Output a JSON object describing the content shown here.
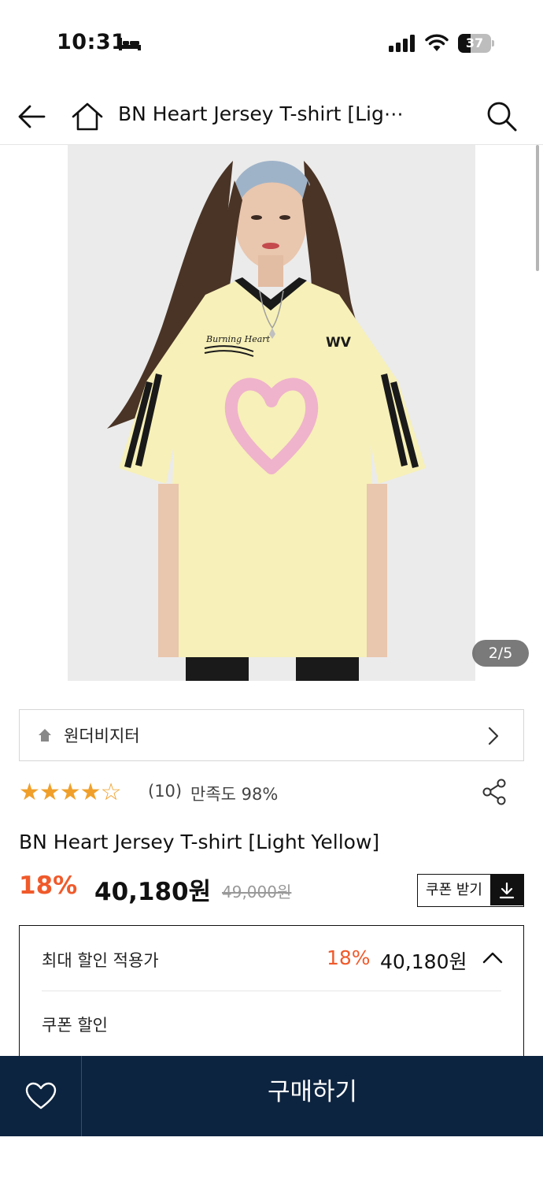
{
  "status_bar": {
    "time": "10:31",
    "battery_level": "37",
    "battery_fraction": 0.37,
    "icons": [
      "bed-icon",
      "signal-icon",
      "wifi-icon",
      "battery-icon"
    ]
  },
  "nav": {
    "title": "BN Heart Jersey T-shirt [Lig⋯",
    "icons": [
      "back-arrow-icon",
      "home-icon",
      "search-icon"
    ]
  },
  "gallery": {
    "counter": "2/5",
    "colors": {
      "shirt": "#f7f0b8",
      "stripes": "#1a1a1a",
      "heart": "#efb3cc",
      "background": "#ebebeb"
    }
  },
  "brand": {
    "name": "원더비지터"
  },
  "rating": {
    "stars": 4,
    "max_stars": 5,
    "filled": "★★★★",
    "empty": "☆",
    "review_count": "(10)",
    "satisfaction": "만족도 98%"
  },
  "product": {
    "name": "BN Heart Jersey T-shirt [Light Yellow]"
  },
  "price": {
    "discount_rate": "18%",
    "sale_price": "40,180원",
    "original_price": "49,000원",
    "coupon_button_label": "쿠폰 받기"
  },
  "discount_panel": {
    "label": "최대 할인 적용가",
    "rate": "18%",
    "price": "40,180원",
    "coupon_discount_label": "쿠폰 할인"
  },
  "bottom_bar": {
    "buy_label": "구매하기"
  },
  "colors": {
    "accent": "#f05a2b",
    "star": "#f0a02a",
    "bottom_bar": "#0d2440"
  }
}
